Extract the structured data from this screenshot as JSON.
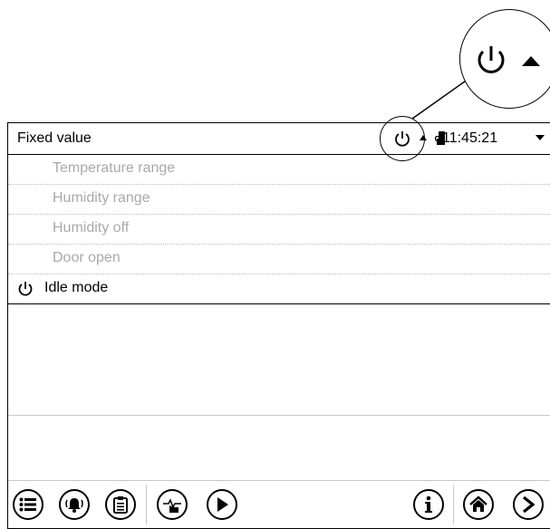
{
  "header": {
    "title": "Fixed value",
    "time": "11:45:21"
  },
  "rows": [
    {
      "label": "Temperature range",
      "state": "disabled"
    },
    {
      "label": "Humidity range",
      "state": "disabled"
    },
    {
      "label": "Humidity off",
      "state": "disabled"
    },
    {
      "label": "Door open",
      "state": "disabled"
    },
    {
      "label": "Idle mode",
      "state": "active",
      "icon": "power-icon"
    }
  ],
  "toolbar": {
    "left_icons": [
      "menu-list-icon",
      "alarm-bell-icon",
      "clipboard-icon",
      "transfer-hand-icon",
      "play-icon"
    ],
    "right_icons": [
      "info-icon",
      "home-icon",
      "next-arrow-icon"
    ]
  }
}
